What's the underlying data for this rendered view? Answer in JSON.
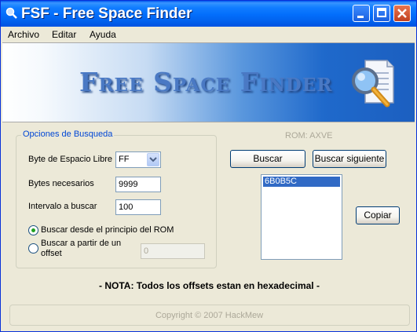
{
  "window": {
    "title": "FSF - Free Space Finder"
  },
  "menu": [
    "Archivo",
    "Editar",
    "Ayuda"
  ],
  "banner": {
    "text": "Free Space Finder"
  },
  "search_options": {
    "group_label": "Opciones de Busqueda",
    "byte_label": "Byte de Espacio Libre",
    "byte_value": "FF",
    "bytes_label": "Bytes necesarios",
    "bytes_value": "9999",
    "interval_label": "Intervalo a buscar",
    "interval_value": "100",
    "radio_start_label": "Buscar desde el principio del ROM",
    "radio_start_selected": true,
    "radio_offset_label_line1": "Buscar a partir de un",
    "radio_offset_label_line2": "offset",
    "offset_value": "0"
  },
  "rom_label": "ROM: AXVE",
  "buttons": {
    "search": "Buscar",
    "search_next": "Buscar siguiente",
    "copy": "Copiar"
  },
  "results": [
    "6B0B5C"
  ],
  "note": "- NOTA: Todos los offsets estan en hexadecimal -",
  "copyright": "Copyright © 2007 HackMew"
}
